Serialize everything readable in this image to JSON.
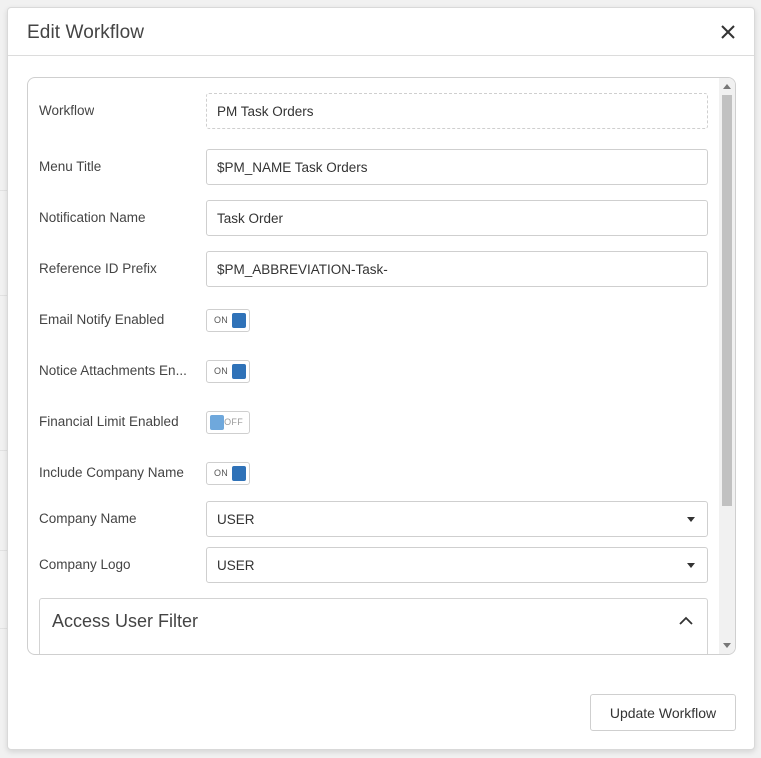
{
  "modal": {
    "title": "Edit Workflow"
  },
  "form": {
    "workflow": {
      "label": "Workflow",
      "value": "PM Task Orders"
    },
    "menu_title": {
      "label": "Menu Title",
      "value": "$PM_NAME Task Orders"
    },
    "notification_name": {
      "label": "Notification Name",
      "value": "Task Order"
    },
    "reference_id_prefix": {
      "label": "Reference ID Prefix",
      "value": "$PM_ABBREVIATION-Task-"
    },
    "email_notify_enabled": {
      "label": "Email Notify Enabled",
      "state": "ON"
    },
    "notice_attachments_enabled": {
      "label": "Notice Attachments En...",
      "state": "ON"
    },
    "financial_limit_enabled": {
      "label": "Financial Limit Enabled",
      "state": "OFF"
    },
    "include_company_name": {
      "label": "Include Company Name",
      "state": "ON"
    },
    "company_name": {
      "label": "Company Name",
      "value": "USER"
    },
    "company_logo": {
      "label": "Company Logo",
      "value": "USER"
    }
  },
  "access_user_filter": {
    "title": "Access User Filter"
  },
  "footer": {
    "update_label": "Update Workflow"
  },
  "colors": {
    "toggle_on": "#2f72b8",
    "toggle_off": "#6fa8dc"
  },
  "icons": {
    "close": "close-icon",
    "dropdown": "caret-down-icon",
    "collapse": "chevron-up-icon"
  }
}
